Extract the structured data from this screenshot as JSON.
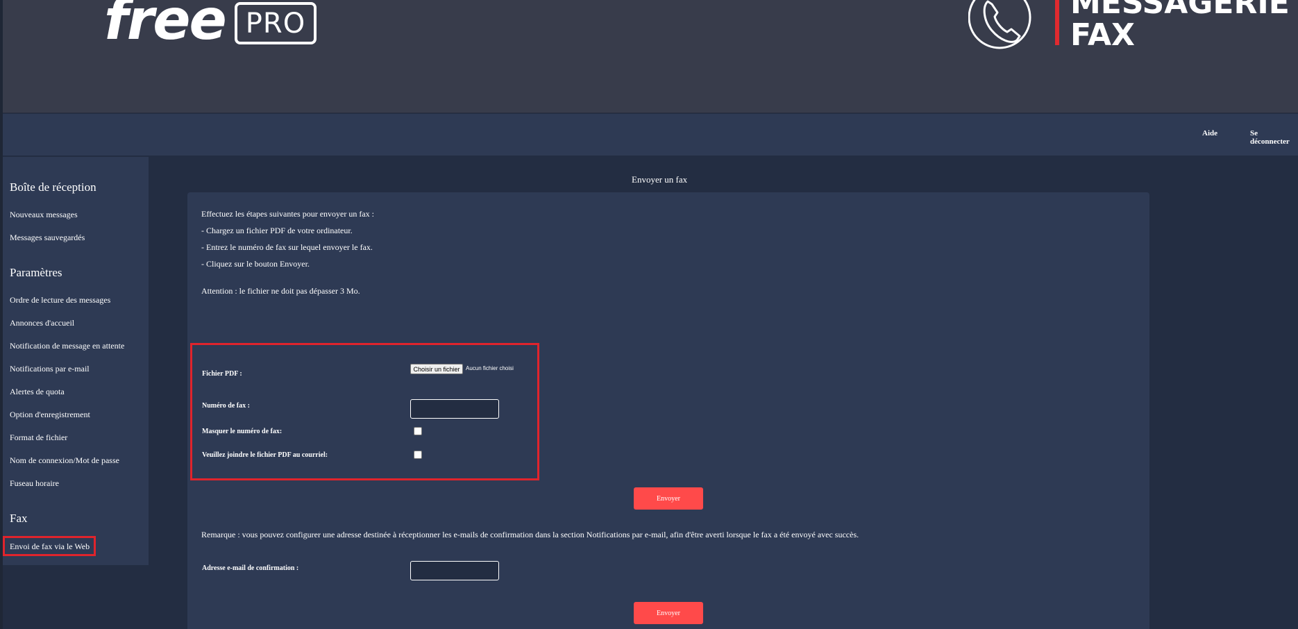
{
  "header": {
    "logo_free": "free",
    "logo_pro": "PRO",
    "title_line1": "MESSAGERIE",
    "title_line2": "FAX",
    "accent_color": "#e0242c"
  },
  "nav": {
    "help": "Aide",
    "logout": "Se déconnecter"
  },
  "sidebar": {
    "inbox_heading": "Boîte de réception",
    "inbox_items": [
      "Nouveaux messages",
      "Messages sauvegardés"
    ],
    "settings_heading": "Paramètres",
    "settings_items": [
      "Ordre de lecture des messages",
      "Annonces d'accueil",
      "Notification de message en attente",
      "Notifications par e-mail",
      "Alertes de quota",
      "Option d'enregistrement",
      "Format de fichier",
      "Nom de connexion/Mot de passe",
      "Fuseau horaire"
    ],
    "fax_heading": "Fax",
    "fax_items": [
      "Envoi de fax via le Web"
    ]
  },
  "main": {
    "title": "Envoyer un fax",
    "instructions": [
      "Effectuez les étapes suivantes pour envoyer un fax :",
      "- Chargez un fichier PDF de votre ordinateur.",
      "- Entrez le numéro de fax sur lequel envoyer le fax.",
      "- Cliquez sur le bouton Envoyer."
    ],
    "warning": "Attention : le fichier ne doit pas dépasser 3 Mo.",
    "form": {
      "pdf_label": "Fichier PDF :",
      "file_button": "Choisir un fichier",
      "file_status": "Aucun fichier choisi",
      "fax_number_label": "Numéro de fax :",
      "fax_number_value": "",
      "hide_number_label": "Masquer le numéro de fax:",
      "attach_pdf_label": "Veuillez joindre le fichier PDF au courriel:",
      "send_label": "Envoyer"
    },
    "remark": "Remarque : vous pouvez configurer une adresse destinée à réceptionner les e-mails de confirmation dans la section Notifications par e-mail, afin d'être averti lorsque le fax a été envoyé avec succès.",
    "confirm_email_label": "Adresse e-mail de confirmation :",
    "confirm_email_value": "",
    "send2_label": "Envoyer"
  }
}
